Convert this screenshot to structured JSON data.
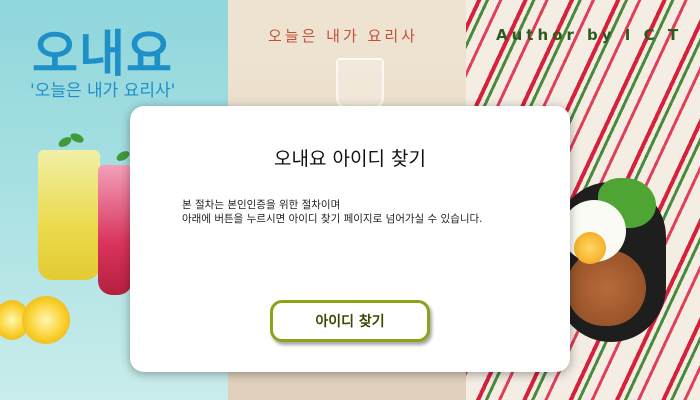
{
  "banner": {
    "logo": "오내요",
    "logo_subtitle": "'오늘은 내가 요리사'",
    "middle_title": "오늘은 내가 요리사",
    "author": "Author by I C T"
  },
  "modal": {
    "title": "오내요 아이디 찾기",
    "description_lines": [
      "본 절차는 본인인증을 위한 절차이며",
      "아래에 버튼을 누르시면 아이디 찾기 페이지로 넘어가실 수 있습니다."
    ],
    "button_label": "아이디 찾기"
  },
  "colors": {
    "logo": "#1f8fc8",
    "button_border": "#8aa41a",
    "middle_title": "#c4503a",
    "author": "#2d5a1e"
  }
}
